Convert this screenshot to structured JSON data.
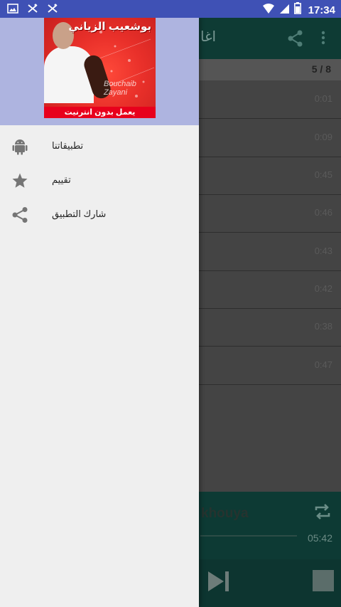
{
  "status_bar": {
    "time": "17:34",
    "left_icons": [
      "image-icon",
      "notification-icon",
      "notification-icon"
    ],
    "right_icons": [
      "wifi-icon",
      "signal-icon",
      "battery-icon"
    ]
  },
  "background_app": {
    "toolbar_title": "اغا",
    "counter": "5 / 8",
    "list_durations": [
      "0:01",
      "0:09",
      "0:45",
      "0:46",
      "0:43",
      "0:42",
      "0:38",
      "0:47"
    ],
    "now_playing_title": "khouya",
    "now_playing_duration": "05:42"
  },
  "drawer": {
    "header": {
      "artist_arabic": "بوشعيب الزياني",
      "artist_latin": "Bouchaib Zayani",
      "banner": "يعمل بدون انترنيت"
    },
    "items": [
      {
        "label": "تطبيقاتنا",
        "icon": "android-icon"
      },
      {
        "label": "تقييم",
        "icon": "star-icon"
      },
      {
        "label": "شارك التطبيق",
        "icon": "share-icon"
      }
    ]
  },
  "colors": {
    "status_bar": "#3f51b5",
    "drawer_header": "#aeb4e0",
    "drawer_bg": "#efefef",
    "icon_gray": "#757575",
    "banner_red": "#e8001c"
  }
}
